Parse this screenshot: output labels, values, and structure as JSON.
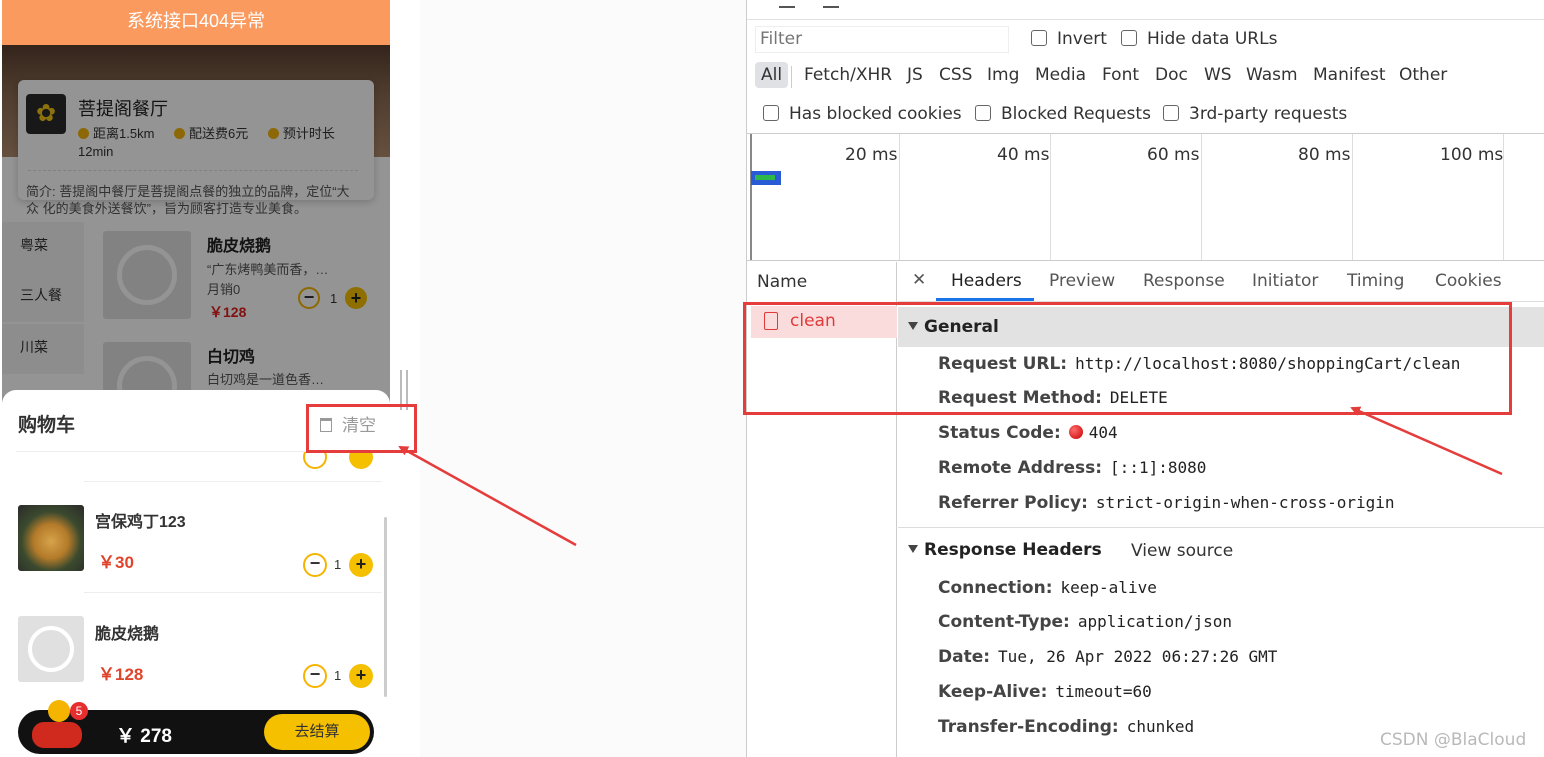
{
  "phone": {
    "header_title": "系统接口404异常",
    "shop": {
      "name": "菩提阁餐厅",
      "distance": "距离1.5km",
      "delivery_fee": "配送费6元",
      "eta_label": "预计时长",
      "eta_value": "12min",
      "description": "简介: 菩提阁中餐厅是菩提阁点餐的独立的品牌，定位“大众 化的美食外送餐饮”，旨为顾客打造专业美食。"
    },
    "categories": [
      "粤菜",
      "三人餐",
      "川菜"
    ],
    "dishes": [
      {
        "name": "脆皮烧鹅",
        "desc": "“广东烤鸭美而香，…",
        "sales": "月销0",
        "price": "￥128",
        "qty": "1"
      },
      {
        "name": "白切鸡",
        "desc": "白切鸡是一道色香…"
      }
    ],
    "cart": {
      "title": "购物车",
      "clear_label": "清空",
      "items": [
        {
          "name": "宫保鸡丁123",
          "price": "￥30",
          "qty": "1"
        },
        {
          "name": "脆皮烧鹅",
          "price": "￥128",
          "qty": "1"
        }
      ],
      "badge_count": "5",
      "total": "￥ 278",
      "checkout_label": "去结算"
    }
  },
  "devtools": {
    "filter_placeholder": "Filter",
    "checks_row1": [
      "Invert",
      "Hide data URLs"
    ],
    "types": [
      "All",
      "Fetch/XHR",
      "JS",
      "CSS",
      "Img",
      "Media",
      "Font",
      "Doc",
      "WS",
      "Wasm",
      "Manifest",
      "Other"
    ],
    "checks_row2": [
      "Has blocked cookies",
      "Blocked Requests",
      "3rd-party requests"
    ],
    "timeline_ticks": [
      "20 ms",
      "40 ms",
      "60 ms",
      "80 ms",
      "100 ms"
    ],
    "name_header": "Name",
    "request_name": "clean",
    "tabs": [
      "Headers",
      "Preview",
      "Response",
      "Initiator",
      "Timing",
      "Cookies"
    ],
    "general": {
      "title": "General",
      "rows": [
        {
          "key": "Request URL:",
          "value": "http://localhost:8080/shoppingCart/clean"
        },
        {
          "key": "Request Method:",
          "value": "DELETE"
        },
        {
          "key": "Status Code:",
          "value": "404"
        },
        {
          "key": "Remote Address:",
          "value": "[::1]:8080"
        },
        {
          "key": "Referrer Policy:",
          "value": "strict-origin-when-cross-origin"
        }
      ]
    },
    "response_headers": {
      "title": "Response Headers",
      "view_source": "View source",
      "rows": [
        {
          "key": "Connection:",
          "value": "keep-alive"
        },
        {
          "key": "Content-Type:",
          "value": "application/json"
        },
        {
          "key": "Date:",
          "value": "Tue, 26 Apr 2022 06:27:26 GMT"
        },
        {
          "key": "Keep-Alive:",
          "value": "timeout=60"
        },
        {
          "key": "Transfer-Encoding:",
          "value": "chunked"
        }
      ]
    }
  },
  "watermark": "CSDN @BlaCloud",
  "colors": {
    "header_orange": "#fb9a5f",
    "accent_yellow": "#f5c000",
    "annotation_red": "#e53c3c",
    "error_red": "#e03a3a",
    "devtools_blue": "#1a73e8"
  }
}
